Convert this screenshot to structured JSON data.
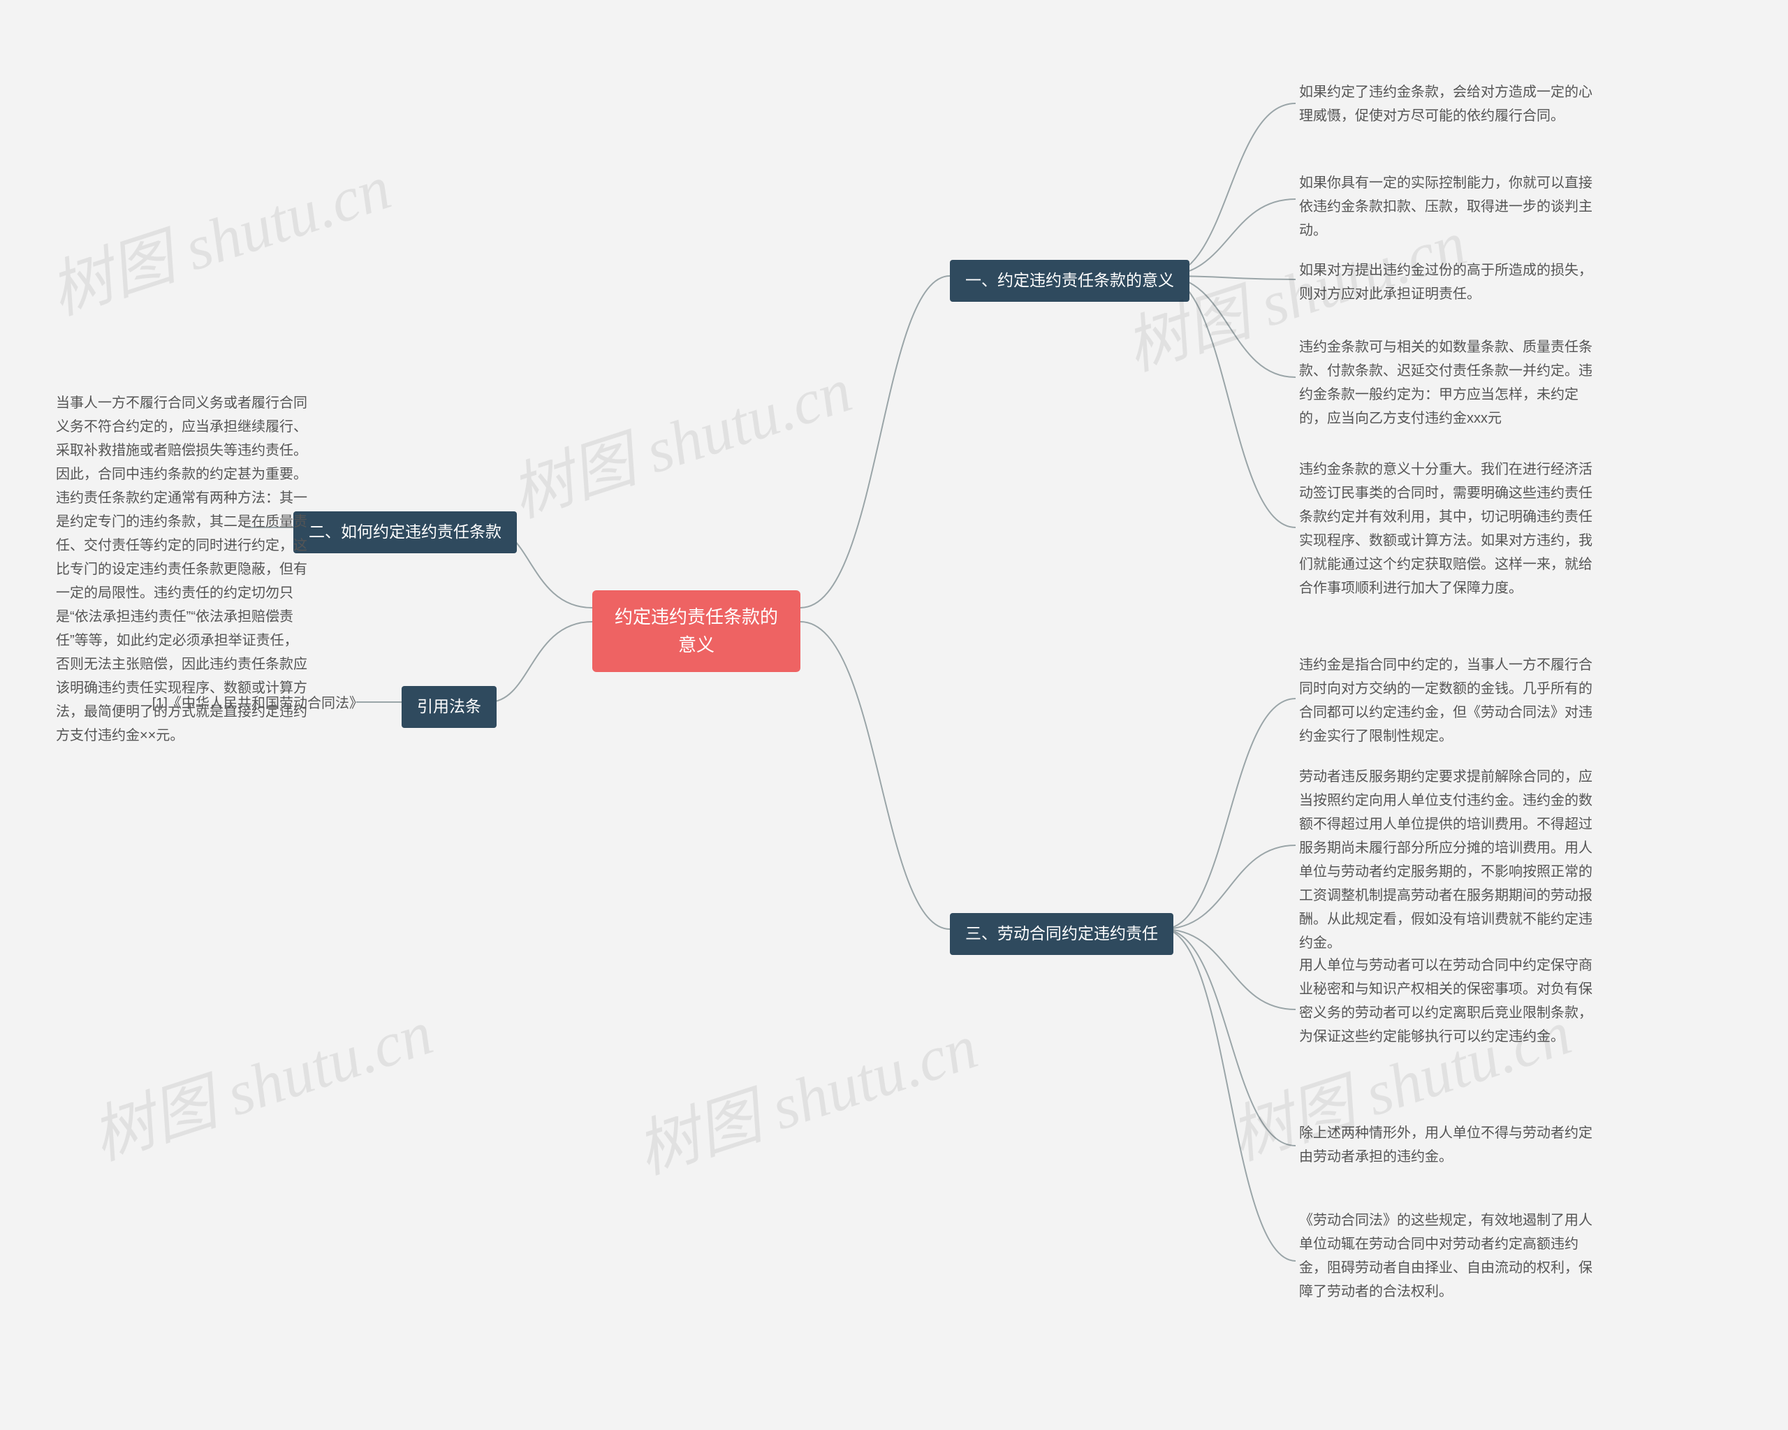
{
  "watermark": "树图 shutu.cn",
  "root": {
    "title": "约定违约责任条款的意义"
  },
  "branches": {
    "b1": {
      "title": "一、约定违约责任条款的意义",
      "leaves": [
        "如果约定了违约金条款，会给对方造成一定的心理威慑，促使对方尽可能的依约履行合同。",
        "如果你具有一定的实际控制能力，你就可以直接依违约金条款扣款、压款，取得进一步的谈判主动。",
        "如果对方提出违约金过份的高于所造成的损失，则对方应对此承担证明责任。",
        "违约金条款可与相关的如数量条款、质量责任条款、付款条款、迟延交付责任条款一并约定。违约金条款一般约定为：甲方应当怎样，未约定的，应当向乙方支付违约金xxx元",
        "违约金条款的意义十分重大。我们在进行经济活动签订民事类的合同时，需要明确这些违约责任条款约定并有效利用，其中，切记明确违约责任实现程序、数额或计算方法。如果对方违约，我们就能通过这个约定获取赔偿。这样一来，就给合作事项顺利进行加大了保障力度。"
      ]
    },
    "b2": {
      "title": "二、如何约定违约责任条款",
      "leaves": [
        "当事人一方不履行合同义务或者履行合同义务不符合约定的，应当承担继续履行、采取补救措施或者赔偿损失等违约责任。因此，合同中违约条款的约定甚为重要。　违约责任条款约定通常有两种方法：其一是约定专门的违约条款，其二是在质量责任、交付责任等约定的同时进行约定，这比专门的设定违约责任条款更隐蔽，但有一定的局限性。违约责任的约定切勿只是“依法承担违约责任”“依法承担赔偿责任”等等，如此约定必须承担举证责任，否则无法主张赔偿，因此违约责任条款应该明确违约责任实现程序、数额或计算方法，最简便明了的方式就是直接约定违约方支付违约金××元。"
      ]
    },
    "b3": {
      "title": "三、劳动合同约定违约责任",
      "leaves": [
        "违约金是指合同中约定的，当事人一方不履行合同时向对方交纳的一定数额的金钱。几乎所有的合同都可以约定违约金，但《劳动合同法》对违约金实行了限制性规定。",
        "劳动者违反服务期约定要求提前解除合同的，应当按照约定向用人单位支付违约金。违约金的数额不得超过用人单位提供的培训费用。不得超过服务期尚未履行部分所应分摊的培训费用。用人单位与劳动者约定服务期的，不影响按照正常的工资调整机制提高劳动者在服务期期间的劳动报酬。从此规定看，假如没有培训费就不能约定违约金。",
        "用人单位与劳动者可以在劳动合同中约定保守商业秘密和与知识产权相关的保密事项。对负有保密义务的劳动者可以约定离职后竞业限制条款，为保证这些约定能够执行可以约定违约金。",
        "除上述两种情形外，用人单位不得与劳动者约定由劳动者承担的违约金。",
        "《劳动合同法》的这些规定，有效地遏制了用人单位动辄在劳动合同中对劳动者约定高额违约金，阻碍劳动者自由择业、自由流动的权利，保障了劳动者的合法权利。"
      ]
    },
    "law": {
      "title": "引用法条",
      "leaves": [
        "[1]《中华人民共和国劳动合同法》"
      ]
    }
  }
}
